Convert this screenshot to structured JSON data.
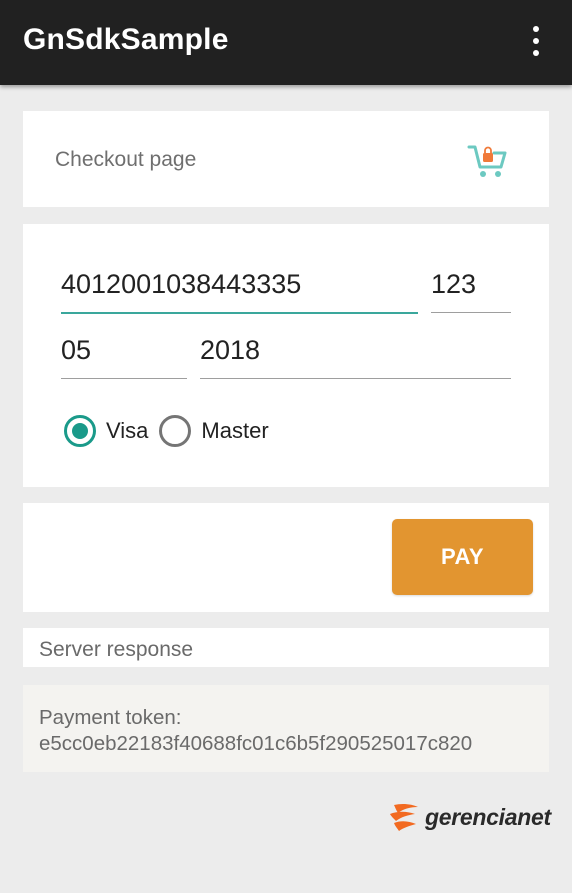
{
  "app": {
    "title": "GnSdkSample",
    "menu_icon": "overflow-vertical-dots-icon"
  },
  "checkout": {
    "title": "Checkout page",
    "icon": "cart-lock-icon"
  },
  "form": {
    "card_number": "4012001038443335",
    "cvv": "123",
    "expiry_month": "05",
    "expiry_year": "2018",
    "brands": [
      {
        "label": "Visa",
        "selected": true
      },
      {
        "label": "Master",
        "selected": false
      }
    ]
  },
  "pay": {
    "label": "PAY"
  },
  "server": {
    "label": "Server response"
  },
  "token": {
    "label": "Payment token:",
    "value": "e5cc0eb22183f40688fc01c6b5f290525017c820"
  },
  "brand": {
    "name": "gerencianet"
  },
  "colors": {
    "appbar": "#212121",
    "accent": "#1a9a8a",
    "focus_underline": "#3aa79c",
    "pay_button": "#e29530",
    "brand_orange": "#f26a21"
  }
}
